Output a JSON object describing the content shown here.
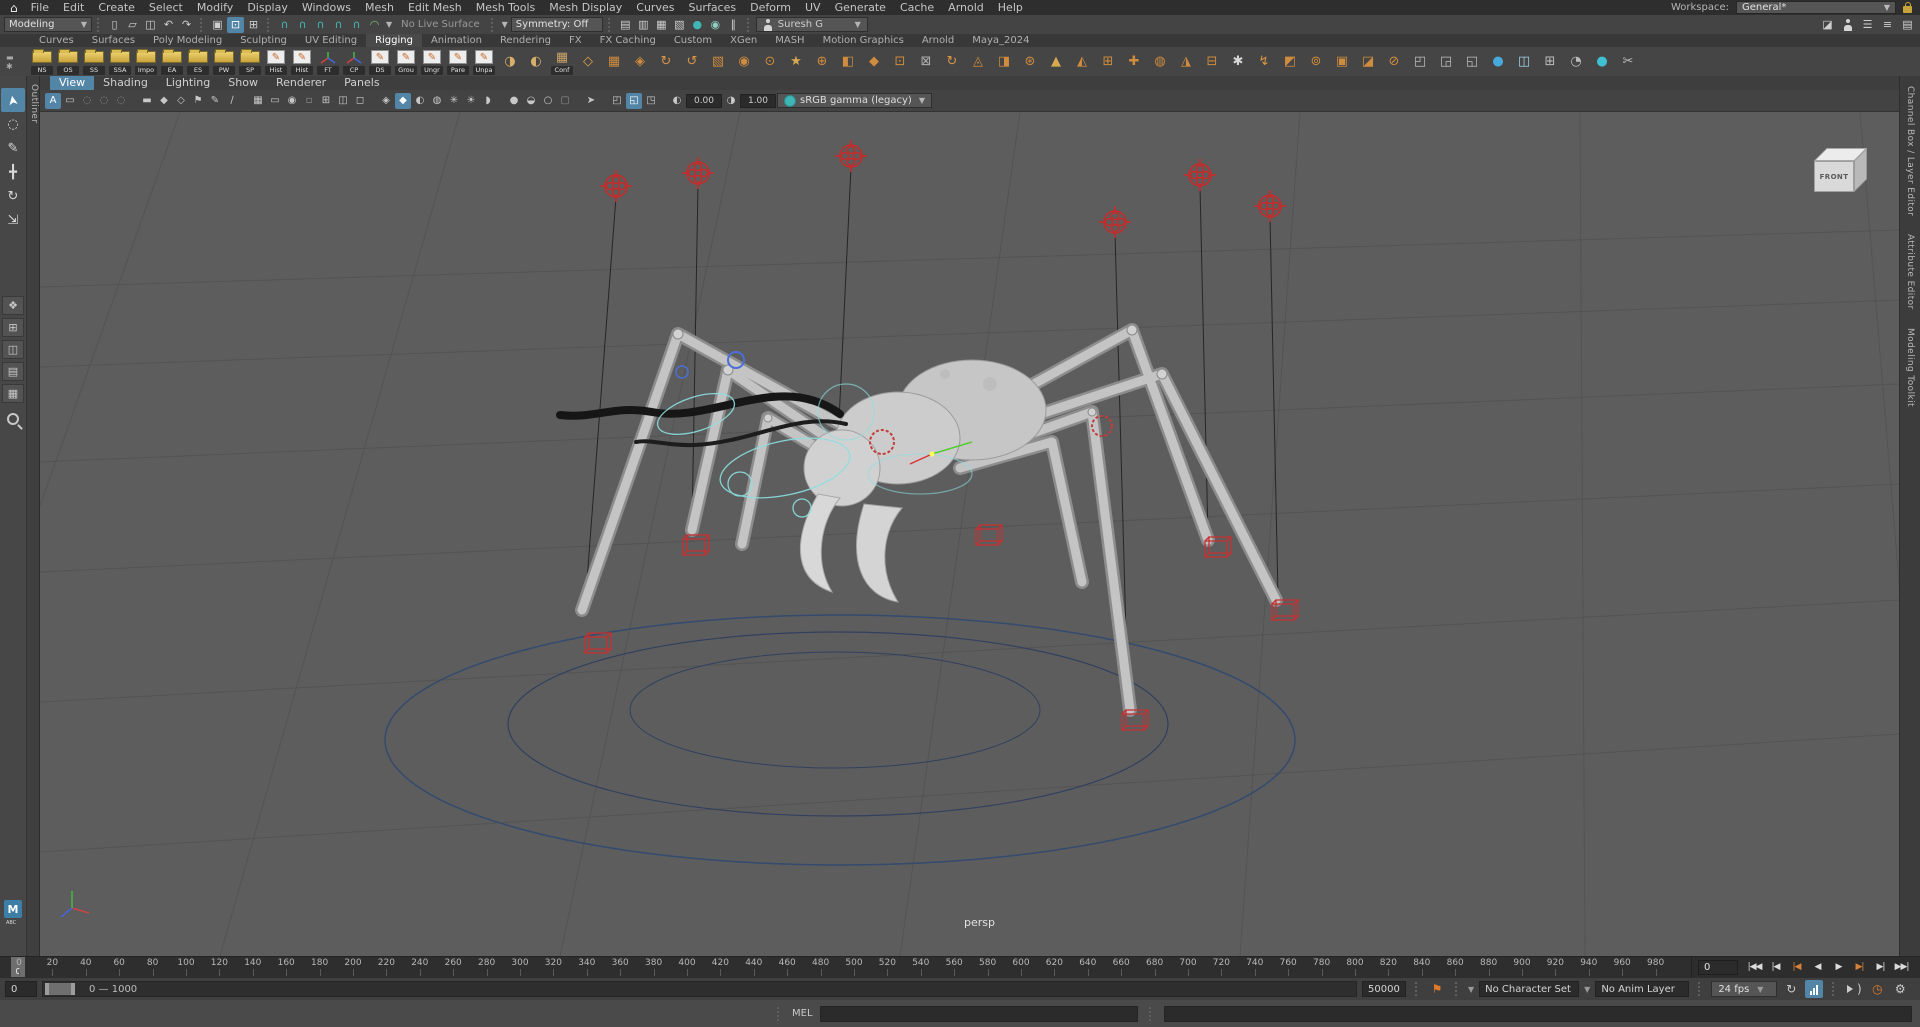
{
  "menu_bar": {
    "app_icon": "⌂",
    "items": [
      "File",
      "Edit",
      "Create",
      "Select",
      "Modify",
      "Display",
      "Windows",
      "Mesh",
      "Edit Mesh",
      "Mesh Tools",
      "Mesh Display",
      "Curves",
      "Surfaces",
      "Deform",
      "UV",
      "Generate",
      "Cache",
      "Arnold",
      "Help"
    ],
    "workspace_label": "Workspace:",
    "workspace_value": "General*"
  },
  "status_line": {
    "mode": "Modeling",
    "file_icons": [
      {
        "n": "new-scene-icon",
        "g": "▯"
      },
      {
        "n": "open-scene-icon",
        "g": "▱"
      },
      {
        "n": "save-scene-icon",
        "g": "◫"
      },
      {
        "n": "undo-icon",
        "g": "↶"
      },
      {
        "n": "redo-icon",
        "g": "↷"
      }
    ],
    "selection_icons": [
      {
        "n": "select-hierarchy-icon",
        "g": "▣"
      },
      {
        "n": "select-object-icon",
        "g": "⊡",
        "active": true
      },
      {
        "n": "select-component-icon",
        "g": "⊞"
      }
    ],
    "snap_icons": [
      {
        "n": "snap-grid-icon",
        "g": "∩",
        "c": "#45b8b8"
      },
      {
        "n": "snap-curve-icon",
        "g": "∩",
        "c": "#45b8b8"
      },
      {
        "n": "snap-point-icon",
        "g": "∩",
        "c": "#45b8b8"
      },
      {
        "n": "snap-projected-center-icon",
        "g": "∩",
        "c": "#45b8b8"
      },
      {
        "n": "snap-view-plane-icon",
        "g": "∩",
        "c": "#45b8b8"
      },
      {
        "n": "make-live-icon",
        "g": "◠",
        "c": "#7ec27e"
      }
    ],
    "no_live_surface": "No Live Surface",
    "symmetry": "Symmetry: Off",
    "render_icons": [
      {
        "n": "render-icon",
        "g": "▤"
      },
      {
        "n": "ipr-render-icon",
        "g": "▥"
      },
      {
        "n": "render-settings-icon",
        "g": "▦"
      },
      {
        "n": "display-render-icon",
        "g": "▧"
      },
      {
        "n": "hypershade-icon",
        "g": "●",
        "c": "#3fb5b5"
      },
      {
        "n": "render-view-icon",
        "g": "◉",
        "c": "#8fd0c0"
      },
      {
        "n": "pause-icon",
        "g": "∥"
      }
    ],
    "user_name": "Suresh G",
    "right_icons": [
      {
        "n": "modeling-toolkit-icon",
        "g": "◪"
      },
      {
        "n": "character-controls-icon",
        "g": "person"
      },
      {
        "n": "channel-box-icon",
        "g": "☰"
      },
      {
        "n": "attribute-editor-icon",
        "g": "≡"
      },
      {
        "n": "display-layers-icon",
        "g": "▤"
      }
    ]
  },
  "shelf": {
    "tabs": [
      "Curves",
      "Surfaces",
      "Poly Modeling",
      "Sculpting",
      "UV Editing",
      "Rigging",
      "Animation",
      "Rendering",
      "FX",
      "FX Caching",
      "Custom",
      "XGen",
      "MASH",
      "Motion Graphics",
      "Arnold",
      "Maya_2024"
    ],
    "active_tab": "Rigging",
    "items": [
      {
        "t": "folder",
        "label": "NS"
      },
      {
        "t": "folder",
        "label": "OS"
      },
      {
        "t": "folder",
        "label": "SS"
      },
      {
        "t": "folder",
        "label": "SSA"
      },
      {
        "t": "folder",
        "label": "Impo"
      },
      {
        "t": "folder",
        "label": "EA"
      },
      {
        "t": "folder",
        "label": "ES"
      },
      {
        "t": "folder",
        "label": "PW"
      },
      {
        "t": "folder",
        "label": "SP"
      },
      {
        "t": "pencil",
        "label": "Hist"
      },
      {
        "t": "pencil",
        "label": "Hist"
      },
      {
        "t": "axis",
        "label": "FT"
      },
      {
        "t": "axis",
        "label": "CP"
      },
      {
        "t": "pencil",
        "label": "DS"
      },
      {
        "t": "pencil",
        "label": "Grou"
      },
      {
        "t": "pencil",
        "label": "Ungr"
      },
      {
        "t": "pencil",
        "label": "Pare"
      },
      {
        "t": "pencil",
        "label": "Unpa"
      },
      {
        "t": "glyph",
        "g": "◑",
        "c": "#d9b06a"
      },
      {
        "t": "glyph",
        "g": "◐",
        "c": "#d9b06a"
      },
      {
        "t": "glyph",
        "g": "▦",
        "c": "#c9a567",
        "label": "Conf"
      },
      {
        "t": "glyph",
        "g": "◇",
        "c": "#e0a048"
      },
      {
        "t": "glyph",
        "g": "▦",
        "c": "#cf8b3e"
      },
      {
        "t": "glyph",
        "g": "◈",
        "c": "#cf8b3e"
      },
      {
        "t": "glyph",
        "g": "↻",
        "c": "#d89545"
      },
      {
        "t": "glyph",
        "g": "↺",
        "c": "#d89545"
      },
      {
        "t": "glyph",
        "g": "▧",
        "c": "#cf8b3e"
      },
      {
        "t": "glyph",
        "g": "◉",
        "c": "#cf8b3e"
      },
      {
        "t": "glyph",
        "g": "⊙",
        "c": "#cf8b3e"
      },
      {
        "t": "glyph",
        "g": "★",
        "c": "#d8a84e"
      },
      {
        "t": "glyph",
        "g": "⊕",
        "c": "#cf8b3e"
      },
      {
        "t": "glyph",
        "g": "◧",
        "c": "#cf8b3e"
      },
      {
        "t": "glyph",
        "g": "◆",
        "c": "#cf8b3e"
      },
      {
        "t": "glyph",
        "g": "⊡",
        "c": "#cf8b3e"
      },
      {
        "t": "glyph",
        "g": "⊠",
        "c": "#b0b0b0"
      },
      {
        "t": "glyph",
        "g": "↻",
        "c": "#d89545"
      },
      {
        "t": "glyph",
        "g": "◬",
        "c": "#cf8b3e"
      },
      {
        "t": "glyph",
        "g": "◨",
        "c": "#cf8b3e"
      },
      {
        "t": "glyph",
        "g": "⊛",
        "c": "#cf8b3e"
      },
      {
        "t": "glyph",
        "g": "▲",
        "c": "#d8a84e"
      },
      {
        "t": "glyph",
        "g": "◭",
        "c": "#cf8b3e"
      },
      {
        "t": "glyph",
        "g": "⊞",
        "c": "#cf8b3e"
      },
      {
        "t": "glyph",
        "g": "✚",
        "c": "#cf8b3e"
      },
      {
        "t": "glyph",
        "g": "◍",
        "c": "#cf8b3e"
      },
      {
        "t": "glyph",
        "g": "◮",
        "c": "#cf8b3e"
      },
      {
        "t": "glyph",
        "g": "⊟",
        "c": "#cf8b3e"
      },
      {
        "t": "glyph",
        "g": "✱",
        "c": "#d8d8d8"
      },
      {
        "t": "glyph",
        "g": "↯",
        "c": "#d89545"
      },
      {
        "t": "glyph",
        "g": "◩",
        "c": "#cf8b3e"
      },
      {
        "t": "glyph",
        "g": "⊚",
        "c": "#cf8b3e"
      },
      {
        "t": "glyph",
        "g": "▣",
        "c": "#cf8b3e"
      },
      {
        "t": "glyph",
        "g": "◪",
        "c": "#cf8b3e"
      },
      {
        "t": "glyph",
        "g": "⊘",
        "c": "#cf8b3e"
      },
      {
        "t": "glyph",
        "g": "◰",
        "c": "#bdbdbd"
      },
      {
        "t": "glyph",
        "g": "◲",
        "c": "#bdbdbd"
      },
      {
        "t": "glyph",
        "g": "◱",
        "c": "#bdbdbd"
      },
      {
        "t": "glyph",
        "g": "●",
        "c": "#46aadc"
      },
      {
        "t": "glyph",
        "g": "◫",
        "c": "#9fd3e6"
      },
      {
        "t": "glyph",
        "g": "⊞",
        "c": "#bdbdbd"
      },
      {
        "t": "glyph",
        "g": "◔",
        "c": "#bdbdbd"
      },
      {
        "t": "glyph",
        "g": "●",
        "c": "#3fc1d3"
      },
      {
        "t": "glyph",
        "g": "✂",
        "c": "#bdbdbd"
      }
    ]
  },
  "toolbox": {
    "tools": [
      {
        "n": "select-tool",
        "g": "➤",
        "rot": true,
        "active": true
      },
      {
        "n": "lasso-select-tool",
        "g": "◌",
        "rot": false
      },
      {
        "n": "paint-select-tool",
        "g": "✎"
      },
      {
        "n": "move-tool",
        "g": "╋"
      },
      {
        "n": "rotate-tool",
        "g": "↻"
      },
      {
        "n": "scale-tool",
        "g": "⇲"
      }
    ],
    "layouts": [
      {
        "n": "layout-single-pane-button",
        "g": "❖"
      },
      {
        "n": "layout-four-pane-button",
        "g": "⊞"
      },
      {
        "n": "layout-two-pane-button",
        "g": "◫"
      },
      {
        "n": "layout-outliner-pane-button",
        "g": "▤"
      },
      {
        "n": "layout-split-pane-button",
        "g": "▦"
      }
    ],
    "badge": "M",
    "badge_sub": "ABC"
  },
  "left_panel_tab": "Outliner",
  "right_tabs": [
    "Channel Box / Layer Editor",
    "Attribute Editor",
    "Modeling Toolkit"
  ],
  "panel_menu": {
    "items": [
      "View",
      "Shading",
      "Lighting",
      "Show",
      "Renderer",
      "Panels"
    ],
    "active": "View"
  },
  "viewport_toolbar": {
    "icons": [
      {
        "n": "camera-attributes-icon",
        "g": "A",
        "active": true
      },
      {
        "n": "film-gate-icon",
        "g": "▭"
      },
      {
        "n": "camera-lock-icon",
        "g": "◌",
        "c": "#8f8f8f"
      },
      {
        "n": "camera-bookmark-icon",
        "g": "◌",
        "c": "#8f8f8f"
      },
      {
        "n": "image-plane-icon",
        "g": "◌",
        "c": "#8f8f8f"
      },
      {
        "sep": true
      },
      {
        "n": "playblast-icon",
        "g": "▬"
      },
      {
        "n": "pan-zoom-icon",
        "g": "◆"
      },
      {
        "n": "oversampling-icon",
        "g": "◇"
      },
      {
        "n": "view-flag-icon",
        "g": "⚑"
      },
      {
        "n": "grease-pencil-icon",
        "g": "✎"
      },
      {
        "n": "annotate-icon",
        "g": "∕"
      },
      {
        "sep": true
      },
      {
        "n": "resolution-gate-icon",
        "g": "▦"
      },
      {
        "n": "gate-mask-icon",
        "g": "▭"
      },
      {
        "n": "field-chart-icon",
        "g": "◉"
      },
      {
        "n": "safe-action-icon",
        "g": "▫",
        "c": "#8f8f8f"
      },
      {
        "n": "safe-title-icon",
        "g": "⊞"
      },
      {
        "n": "frame-all-icon",
        "g": "◫"
      },
      {
        "n": "frame-selected-icon",
        "g": "◻"
      },
      {
        "sep": true
      },
      {
        "n": "wireframe-display-icon",
        "g": "◈"
      },
      {
        "n": "shaded-display-icon",
        "g": "◆",
        "active": true
      },
      {
        "n": "textured-display-icon",
        "g": "◐"
      },
      {
        "n": "use-all-lights-icon",
        "g": "◍"
      },
      {
        "n": "shadows-icon",
        "g": "✳"
      },
      {
        "n": "ambient-occlusion-icon",
        "g": "☀"
      },
      {
        "n": "motion-blur-icon",
        "g": "◗"
      },
      {
        "sep": true
      },
      {
        "n": "xray-icon",
        "g": "●"
      },
      {
        "n": "xray-joints-icon",
        "g": "◒"
      },
      {
        "n": "xray-active-icon",
        "g": "○"
      },
      {
        "n": "default-material-icon",
        "g": "▢",
        "c": "#8f8f8f"
      },
      {
        "sep": true
      },
      {
        "n": "isolate-select-icon",
        "g": "➤"
      },
      {
        "sep": true
      },
      {
        "n": "plugin-shapes-icon",
        "g": "◰"
      },
      {
        "n": "scene-render-filter-icon",
        "g": "◱",
        "active": true
      },
      {
        "n": "gpu-override-icon",
        "g": "◳"
      },
      {
        "sep": true
      }
    ],
    "exposure": "0.00",
    "gamma": "1.00",
    "color_space": "sRGB gamma (legacy)"
  },
  "viewport": {
    "camera_label": "persp",
    "view_cube": "FRONT"
  },
  "time_slider": {
    "min": 0,
    "max": 1000,
    "label_step": 20,
    "current": "0",
    "playback_buttons": [
      {
        "n": "go-to-start-button",
        "g": "|◀◀"
      },
      {
        "n": "step-back-frame-button",
        "g": "|◀"
      },
      {
        "n": "step-back-key-button",
        "g": "|◀",
        "key": true
      },
      {
        "n": "play-backwards-button",
        "g": "◀"
      },
      {
        "n": "play-forwards-button",
        "g": "▶"
      },
      {
        "n": "step-forward-key-button",
        "g": "▶|",
        "key": true
      },
      {
        "n": "step-forward-frame-button",
        "g": "▶|"
      },
      {
        "n": "go-to-end-button",
        "g": "▶▶|"
      }
    ]
  },
  "range_slider": {
    "start_field": "0",
    "range_label": "0 — 1000",
    "end_field": "50000",
    "character_set": "No Character Set",
    "anim_layer": "No Anim Layer",
    "fps": "24 fps"
  },
  "command_line": {
    "label": "MEL"
  }
}
